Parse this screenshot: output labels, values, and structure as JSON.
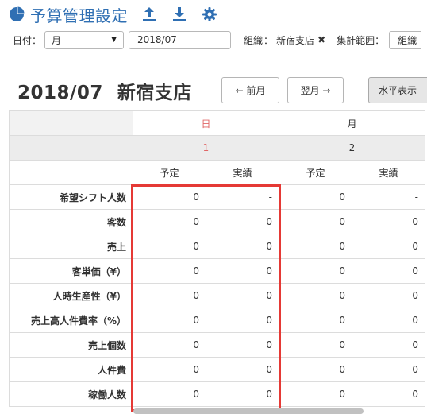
{
  "app": {
    "title": "予算管理設定",
    "icons": [
      "pie-chart-icon",
      "upload-icon",
      "download-icon",
      "gear-icon"
    ],
    "brand_color": "#2f6fb3"
  },
  "filters": {
    "date_label": "日付：",
    "period_select": "月",
    "date_value": "2018/07",
    "org_label": "組織",
    "org_colon": "：",
    "org_value": "新宿支店",
    "remove_icon": "✖",
    "range_label": "集計範囲：",
    "range_value": "組織"
  },
  "period": {
    "month": "2018/07",
    "store": "新宿支店"
  },
  "buttons": {
    "prev": "← 前月",
    "next": "翌月 →",
    "horizontal": "水平表示"
  },
  "table": {
    "days": [
      {
        "weekday": "日",
        "date": "1",
        "sunday": true
      },
      {
        "weekday": "月",
        "date": "2",
        "sunday": false
      }
    ],
    "subheaders": [
      "予定",
      "実績",
      "予定",
      "実績"
    ],
    "rows": [
      {
        "label": "希望シフト人数",
        "values": [
          "0",
          "-",
          "0",
          "-"
        ]
      },
      {
        "label": "客数",
        "values": [
          "0",
          "0",
          "0",
          "0"
        ]
      },
      {
        "label": "売上",
        "values": [
          "0",
          "0",
          "0",
          "0"
        ]
      },
      {
        "label": "客単価（¥）",
        "values": [
          "0",
          "0",
          "0",
          "0"
        ]
      },
      {
        "label": "人時生産性（¥）",
        "values": [
          "0",
          "0",
          "0",
          "0"
        ]
      },
      {
        "label": "売上高人件費率（%）",
        "values": [
          "0",
          "0",
          "0",
          "0"
        ]
      },
      {
        "label": "売上個数",
        "values": [
          "0",
          "0",
          "0",
          "0"
        ]
      },
      {
        "label": "人件費",
        "values": [
          "0",
          "0",
          "0",
          "0"
        ]
      },
      {
        "label": "稼働人数",
        "values": [
          "0",
          "0",
          "0",
          "0"
        ]
      }
    ],
    "highlight_color": "#e53935"
  }
}
